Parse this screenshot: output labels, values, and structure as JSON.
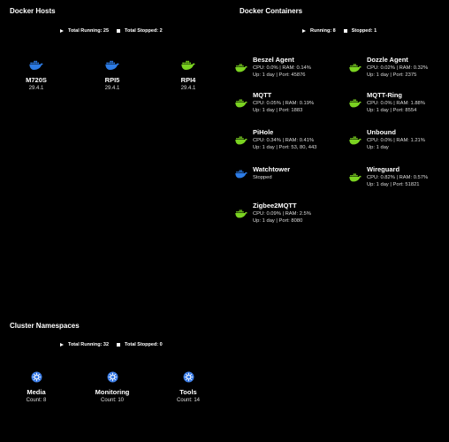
{
  "colors": {
    "running": "#7bd321",
    "stopped": "#2d7ce6",
    "k8s": "#3c7de6"
  },
  "hosts": {
    "title": "Docker Hosts",
    "total_running": "Total Running: 25",
    "total_stopped": "Total Stopped: 2",
    "items": [
      {
        "name": "M720S",
        "version": "29.4.1",
        "icon": "docker-whale-icon",
        "status": "stopped"
      },
      {
        "name": "RPI5",
        "version": "29.4.1",
        "icon": "docker-whale-icon",
        "status": "stopped"
      },
      {
        "name": "RPI4",
        "version": "29.4.1",
        "icon": "docker-whale-icon",
        "status": "running"
      }
    ]
  },
  "containers": {
    "title": "Docker Containers",
    "running": "Running: 8",
    "stopped": "Stopped: 1",
    "items": [
      {
        "name": "Beszel Agent",
        "line1": "CPU: 0.0% | RAM: 0.14%",
        "line2": "Up: 1 day | Port: 45876",
        "status": "running"
      },
      {
        "name": "Dozzle Agent",
        "line1": "CPU: 0.02% | RAM: 0.32%",
        "line2": "Up: 1 day | Port: 2375",
        "status": "running"
      },
      {
        "name": "MQTT",
        "line1": "CPU: 0.05% | RAM: 0.19%",
        "line2": "Up: 1 day | Port: 1883",
        "status": "running"
      },
      {
        "name": "MQTT-Ring",
        "line1": "CPU: 0.0% | RAM: 1.88%",
        "line2": "Up: 1 day | Port: 8554",
        "status": "running"
      },
      {
        "name": "PiHole",
        "line1": "CPU: 0.34% | RAM: 0.41%",
        "line2": "Up: 1 day | Port: 53, 80, 443",
        "status": "running"
      },
      {
        "name": "Unbound",
        "line1": "CPU: 0.0% | RAM: 1.21%",
        "line2": "Up: 1 day",
        "status": "running"
      },
      {
        "name": "Watchtower",
        "line1": "Stopped",
        "line2": "",
        "status": "stopped"
      },
      {
        "name": "Wireguard",
        "line1": "CPU: 0.82% | RAM: 0.57%",
        "line2": "Up: 1 day | Port: 51821",
        "status": "running"
      },
      {
        "name": "Zigbee2MQTT",
        "line1": "CPU: 0.09% | RAM: 2.5%",
        "line2": "Up: 1 day | Port: 8080",
        "status": "running"
      }
    ]
  },
  "namespaces": {
    "title": "Cluster Namespaces",
    "total_running": "Total Running: 32",
    "total_stopped": "Total Stopped: 0",
    "items": [
      {
        "name": "Media",
        "count": "Count: 8",
        "icon": "kubernetes-helm-icon"
      },
      {
        "name": "Monitoring",
        "count": "Count: 10",
        "icon": "kubernetes-helm-icon"
      },
      {
        "name": "Tools",
        "count": "Count: 14",
        "icon": "kubernetes-helm-icon"
      }
    ]
  }
}
